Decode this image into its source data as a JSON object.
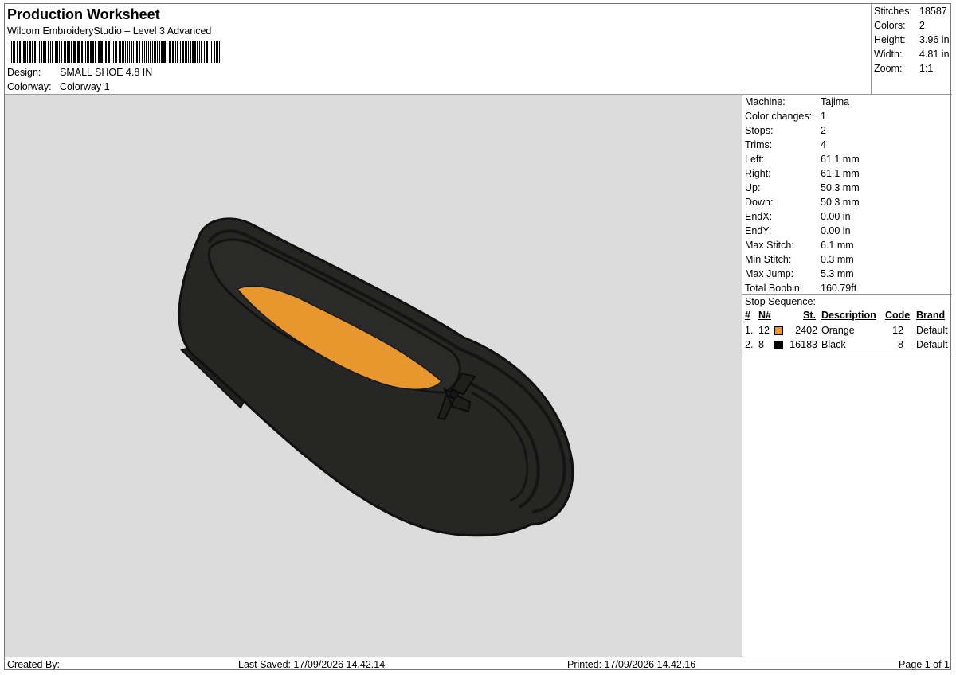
{
  "header": {
    "title": "Production Worksheet",
    "subtitle": "Wilcom EmbroideryStudio – Level 3 Advanced",
    "design_label": "Design:",
    "design_value": "SMALL SHOE 4.8 IN",
    "colorway_label": "Colorway:",
    "colorway_value": "Colorway 1"
  },
  "stats": [
    {
      "label": "Stitches:",
      "value": "18587"
    },
    {
      "label": "Colors:",
      "value": "2"
    },
    {
      "label": "Height:",
      "value": "3.96 in"
    },
    {
      "label": "Width:",
      "value": "4.81 in"
    },
    {
      "label": "Zoom:",
      "value": "1:1"
    }
  ],
  "machine": [
    {
      "label": "Machine:",
      "value": "Tajima"
    },
    {
      "label": "Color changes:",
      "value": "1"
    },
    {
      "label": "Stops:",
      "value": "2"
    },
    {
      "label": "Trims:",
      "value": "4"
    },
    {
      "label": "Left:",
      "value": "61.1 mm"
    },
    {
      "label": "Right:",
      "value": "61.1 mm"
    },
    {
      "label": "Up:",
      "value": "50.3 mm"
    },
    {
      "label": "Down:",
      "value": "50.3 mm"
    },
    {
      "label": "EndX:",
      "value": "0.00 in"
    },
    {
      "label": "EndY:",
      "value": "0.00 in"
    },
    {
      "label": "Max Stitch:",
      "value": "6.1 mm"
    },
    {
      "label": "Min Stitch:",
      "value": "0.3 mm"
    },
    {
      "label": "Max Jump:",
      "value": "5.3 mm"
    },
    {
      "label": "Total Bobbin:",
      "value": "160.79ft"
    }
  ],
  "stop_sequence": {
    "title": "Stop Sequence:",
    "headers": {
      "index": "#",
      "needle": "N#",
      "stitches": "St.",
      "description": "Description",
      "code": "Code",
      "brand": "Brand"
    },
    "rows": [
      {
        "index": "1.",
        "needle": "12",
        "color": "#e8962e",
        "stitches": "2402",
        "description": "Orange",
        "code": "12",
        "brand": "Default"
      },
      {
        "index": "2.",
        "needle": "8",
        "color": "#000000",
        "stitches": "16183",
        "description": "Black",
        "code": "8",
        "brand": "Default"
      }
    ]
  },
  "footer": {
    "created_by": "Created By:",
    "last_saved": "Last Saved: 17/09/2026 14.42.14",
    "printed": "Printed: 17/09/2026 14.42.16",
    "page": "Page 1 of 1"
  },
  "colors": {
    "preview_bg": "#dcdcdc",
    "shoe_black": "#262624",
    "insole_orange": "#e8962e"
  }
}
